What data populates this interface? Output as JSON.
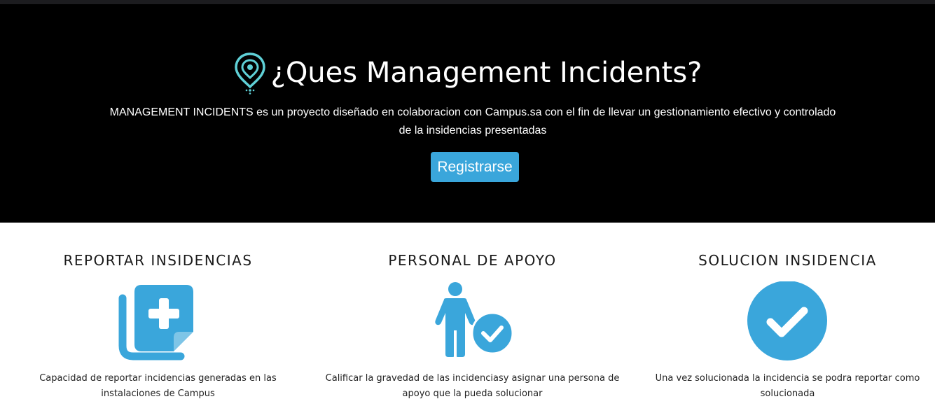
{
  "hero": {
    "title": "¿Ques Management Incidents?",
    "description": "MANAGEMENT INCIDENTS es un proyecto diseñado en colaboracion con Campus.sa con el fin de llevar un gestionamiento efectivo y controlado de la insidencias presentadas",
    "register_label": "Registrarse",
    "icon": "location-pin-icon"
  },
  "features": [
    {
      "title": "REPORTAR INSIDENCIAS",
      "icon": "add-report-icon",
      "description": "Capacidad de reportar incidencias generadas en las instalaciones de Campus"
    },
    {
      "title": "PERSONAL DE APOYO",
      "icon": "person-check-icon",
      "description": "Calificar la gravedad de las incidenciasy asignar una persona de apoyo que la pueda solucionar"
    },
    {
      "title": "SOLUCION INSIDENCIA",
      "icon": "check-circle-icon",
      "description": "Una vez solucionada la incidencia se podra reportar como solucionada"
    }
  ],
  "colors": {
    "accent": "#3aa6db",
    "hero_background": "#000000",
    "pin_icon": "#5fd0d6"
  }
}
